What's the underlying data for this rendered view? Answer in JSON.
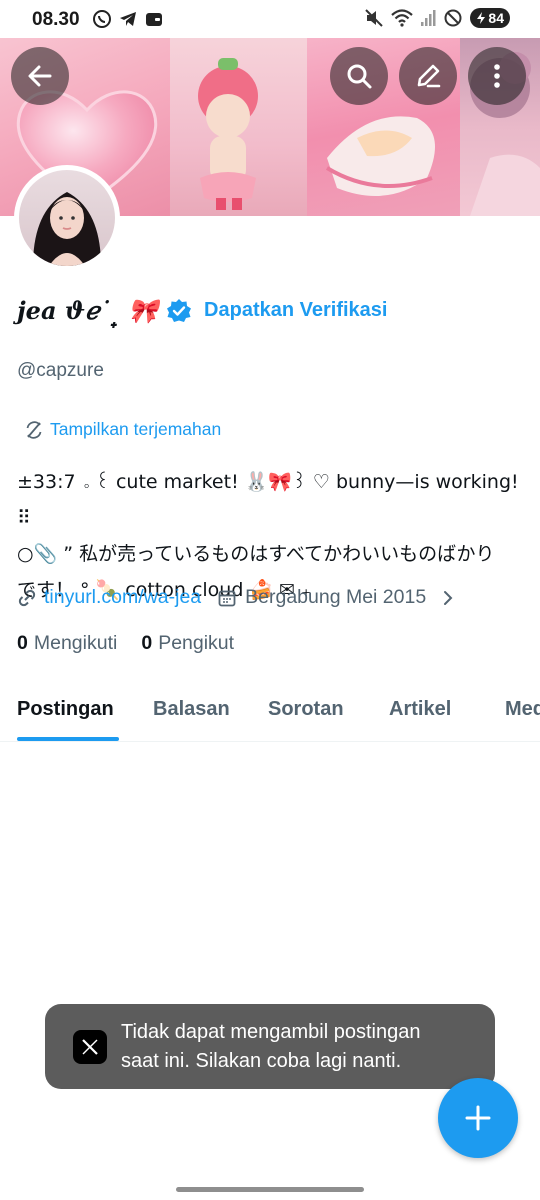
{
  "status_bar": {
    "time": "08.30",
    "battery": "84",
    "left_icons": [
      "whatsapp-icon",
      "telegram-icon",
      "wallet-icon"
    ],
    "right_icons": [
      "mute-icon",
      "wifi-icon",
      "signal-icon",
      "dnd-icon",
      "battery-icon"
    ]
  },
  "header": {
    "back_icon": "arrow-left-icon",
    "search_icon": "search-icon",
    "edit_icon": "pencil-icon",
    "more_icon": "more-vertical-icon"
  },
  "profile": {
    "display_name": "jea ϑℯ˙ ̟ 🎀",
    "verify_label": "Dapatkan Verifikasi",
    "handle": "@capzure",
    "translate_label": "Tampilkan terjemahan",
    "bio_lines": [
      "±33:7 ｡ ꒰ cute market! 🐰🎀꒱ ♡ bunny—is working! ⠿",
      "○📎 ” 私が売っているものはすべてかわいいものばかり",
      "です！ ° 🍡 cotton cloud 🍰 ✉ ₊"
    ],
    "link": "tinyurl.com/wa-jea",
    "joined": "Bergabung Mei 2015",
    "following_count": "0",
    "following_label": "Mengikuti",
    "followers_count": "0",
    "followers_label": "Pengikut"
  },
  "tabs": [
    {
      "label": "Postingan",
      "active": true
    },
    {
      "label": "Balasan",
      "active": false
    },
    {
      "label": "Sorotan",
      "active": false
    },
    {
      "label": "Artikel",
      "active": false
    },
    {
      "label": "Media",
      "active": false
    }
  ],
  "toast": {
    "line1": "Tidak dapat mengambil postingan",
    "line2": "saat ini. Silakan coba lagi nanti."
  },
  "colors": {
    "accent": "#1d9bf0",
    "text_primary": "#0f1419",
    "text_secondary": "#536471",
    "toast_bg": "#5c5c5c"
  }
}
